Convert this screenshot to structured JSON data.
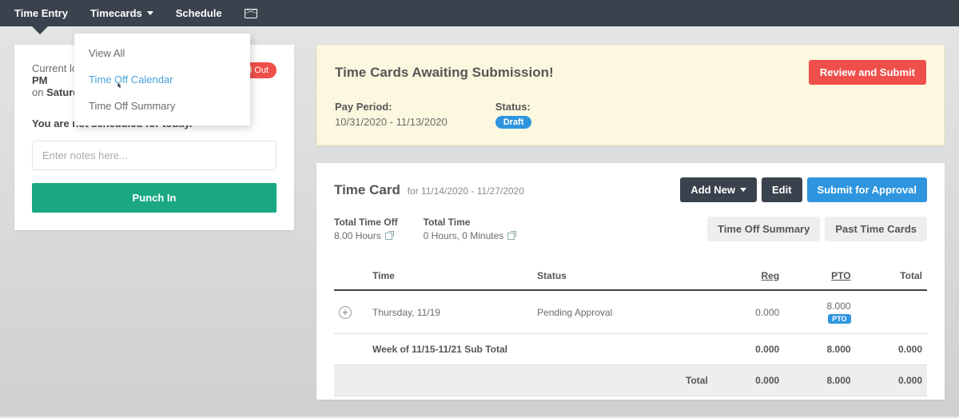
{
  "nav": {
    "time_entry": "Time Entry",
    "timecards": "Timecards",
    "schedule": "Schedule"
  },
  "dropdown": {
    "items": [
      "View All",
      "Time Off Calendar",
      "Time Off Summary"
    ],
    "hover_index": 1
  },
  "punch": {
    "line1_prefix": "Current log",
    "line2": "PM",
    "line3_prefix": "on ",
    "line3_day": "Saturda",
    "status": "Punched Out",
    "schedule_msg": "You are not scheduled for today.",
    "notes_placeholder": "Enter notes here...",
    "button": "Punch In"
  },
  "alert": {
    "title": "Time Cards Awaiting Submission!",
    "review_btn": "Review and Submit",
    "pay_period_label": "Pay Period:",
    "pay_period_value": "10/31/2020 - 11/13/2020",
    "status_label": "Status:",
    "status_value": "Draft"
  },
  "timecard": {
    "title": "Time Card",
    "range_prefix": "for ",
    "range": "11/14/2020 - 11/27/2020",
    "add_new": "Add New",
    "edit": "Edit",
    "submit": "Submit for Approval",
    "total_off_label": "Total Time Off",
    "total_off_value": "8.00 Hours",
    "total_time_label": "Total Time",
    "total_time_value": "0 Hours, 0 Minutes",
    "time_off_summary": "Time Off Summary",
    "past_time_cards": "Past Time Cards",
    "headers": {
      "time": "Time",
      "status": "Status",
      "reg": "Reg",
      "pto": "PTO",
      "total": "Total"
    },
    "rows": [
      {
        "date": "Thursday, 11/19",
        "status": "Pending Approval",
        "reg": "0.000",
        "pto": "8.000",
        "pto_badge": "PTO",
        "total": ""
      }
    ],
    "subtotal": {
      "label": "Week of 11/15-11/21 Sub Total",
      "reg": "0.000",
      "pto": "8.000",
      "total": "0.000"
    },
    "grand_total": {
      "label": "Total",
      "reg": "0.000",
      "pto": "8.000",
      "total": "0.000"
    }
  }
}
